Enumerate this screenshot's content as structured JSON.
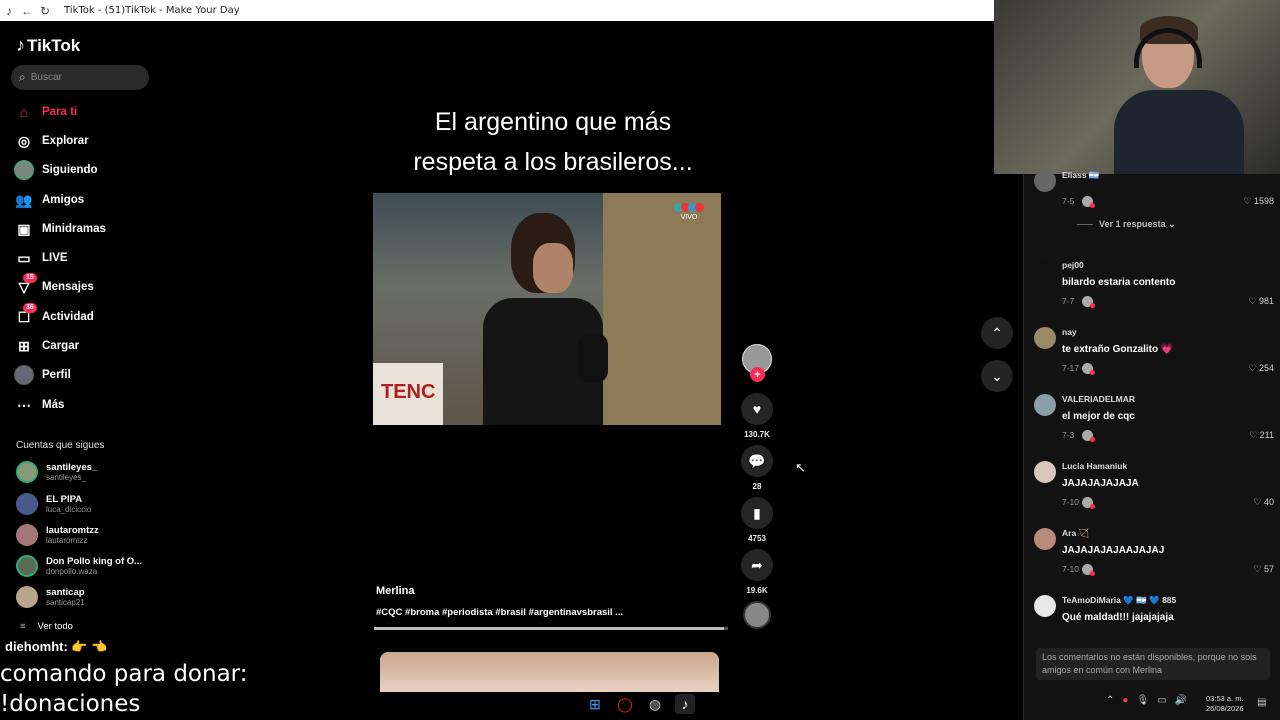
{
  "browser": {
    "title": "TikTok - (51)TikTok - Make Your Day"
  },
  "sidebar": {
    "logo_text": "TikTok",
    "search_placeholder": "Buscar",
    "nav": [
      {
        "label": "Para ti",
        "icon": "home-icon",
        "active": true
      },
      {
        "label": "Explorar",
        "icon": "compass-icon"
      },
      {
        "label": "Siguiendo",
        "icon": "avatar"
      },
      {
        "label": "Amigos",
        "icon": "friends-icon"
      },
      {
        "label": "Minidramas",
        "icon": "film-icon"
      },
      {
        "label": "LIVE",
        "icon": "live-icon"
      },
      {
        "label": "Mensajes",
        "icon": "messages-icon",
        "badge": "15"
      },
      {
        "label": "Actividad",
        "icon": "activity-icon",
        "badge": "36"
      },
      {
        "label": "Cargar",
        "icon": "upload-icon"
      },
      {
        "label": "Perfil",
        "icon": "profile-icon"
      },
      {
        "label": "Más",
        "icon": "more-icon"
      }
    ],
    "following_title": "Cuentas que sigues",
    "following": [
      {
        "name": "santileyes_",
        "user": "santileyes_"
      },
      {
        "name": "EL PIPA",
        "user": "luca_diciccio"
      },
      {
        "name": "lautaromtzz",
        "user": "lautaromtzz"
      },
      {
        "name": "Don Pollo king of O...",
        "user": "donpollo.waza"
      },
      {
        "name": "santicap",
        "user": "santicap21"
      }
    ],
    "see_all": "Ver todo"
  },
  "overlay": {
    "chat_line": "diehomht: 👉 👈",
    "donate_1": "comando para donar:",
    "donate_2": "!donaciones"
  },
  "video": {
    "title_line1": "El argentino que más",
    "title_line2": "respeta a los brasileros...",
    "banner_text": "TENC",
    "live_logo": "VIVO",
    "author": "Merlina",
    "tags": "#CQC #broma #periodista #brasil #argentinavsbrasil  ...",
    "progress": 0.99
  },
  "actions": {
    "likes": "130.7K",
    "comments": "28",
    "saves": "4753",
    "shares": "19.6K"
  },
  "comments": [
    {
      "user": "Eliass 🇦🇷",
      "text": "",
      "date": "7-5",
      "likes": "1598",
      "replies": "Ver 1 respuesta"
    },
    {
      "user": "pej00",
      "text": "bilardo estaria contento",
      "date": "7-7",
      "likes": "981"
    },
    {
      "user": "nay",
      "text": "te extraño Gonzalito 💗",
      "date": "7-17",
      "likes": "254"
    },
    {
      "user": "VALERIADELMAR",
      "text": "el mejor de cqc",
      "date": "7-3",
      "likes": "211"
    },
    {
      "user": "Lucia Hamaniuk",
      "text": "JAJAJAJAJAJA",
      "date": "7-10",
      "likes": "40"
    },
    {
      "user": "Ara 🏹",
      "text": "JAJAJAJAJAAJAJAJ",
      "date": "7-10",
      "likes": "57"
    },
    {
      "user": "TeAmoDiMaria 💙 🇦🇷 💙 885",
      "text": "Qué maldad!!! jajajajaja",
      "date": "",
      "likes": ""
    }
  ],
  "comments_note": "Los comentarios no están disponibles, porque no sois amigos en común con Merlina",
  "taskbar": {
    "time": "03:53 a. m.",
    "date": "26/08/2026"
  }
}
